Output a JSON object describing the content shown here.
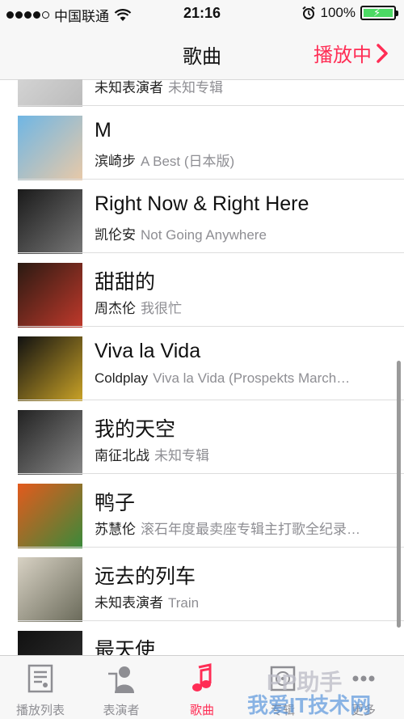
{
  "status_bar": {
    "carrier": "中国联通",
    "time": "21:16",
    "battery_percent": "100%",
    "battery_level": 1.0,
    "signal_bars": 4
  },
  "nav": {
    "title": "歌曲",
    "now_playing_label": "播放中"
  },
  "songs": [
    {
      "title": "",
      "artist": "未知表演者",
      "album": "未知专辑",
      "art_colors": [
        "#ddd",
        "#bbb"
      ]
    },
    {
      "title": "M",
      "artist": "滨崎步",
      "album": "A Best (日本版)",
      "art_colors": [
        "#6fb6e4",
        "#e8c9a8"
      ]
    },
    {
      "title": "Right Now & Right Here",
      "artist": "凯伦安",
      "album": "Not Going Anywhere",
      "art_colors": [
        "#1a1a1a",
        "#777"
      ]
    },
    {
      "title": "甜甜的",
      "artist": "周杰伦",
      "album": "我很忙",
      "art_colors": [
        "#2a1a12",
        "#c0392b"
      ]
    },
    {
      "title": "Viva la Vida",
      "artist": "Coldplay",
      "album": "Viva la Vida (Prospekts March…",
      "art_colors": [
        "#111",
        "#c9a227"
      ]
    },
    {
      "title": "我的天空",
      "artist": "南征北战",
      "album": "未知专辑",
      "art_colors": [
        "#222",
        "#888"
      ]
    },
    {
      "title": "鸭子",
      "artist": "苏慧伦",
      "album": "滚石年度最卖座专辑主打歌全纪录…",
      "art_colors": [
        "#e35a1d",
        "#3a8a3a"
      ]
    },
    {
      "title": "远去的列车",
      "artist": "未知表演者",
      "album": "Train",
      "art_colors": [
        "#d8d2c4",
        "#6a6a5a"
      ]
    },
    {
      "title": "最天使",
      "artist": "",
      "album": "",
      "art_colors": [
        "#111",
        "#333"
      ]
    }
  ],
  "tabs": [
    {
      "label": "播放列表",
      "icon": "playlist-icon",
      "active": false
    },
    {
      "label": "表演者",
      "icon": "artist-icon",
      "active": false
    },
    {
      "label": "歌曲",
      "icon": "music-note-icon",
      "active": true
    },
    {
      "label": "专辑",
      "icon": "album-icon",
      "active": false
    },
    {
      "label": "更多",
      "icon": "more-icon",
      "active": false
    }
  ],
  "colors": {
    "accent": "#ff2d55",
    "secondary_text": "#8e8e93",
    "battery": "#4cd964"
  },
  "watermark": {
    "brand": "PP助手",
    "site": "我爱IT技术网"
  }
}
